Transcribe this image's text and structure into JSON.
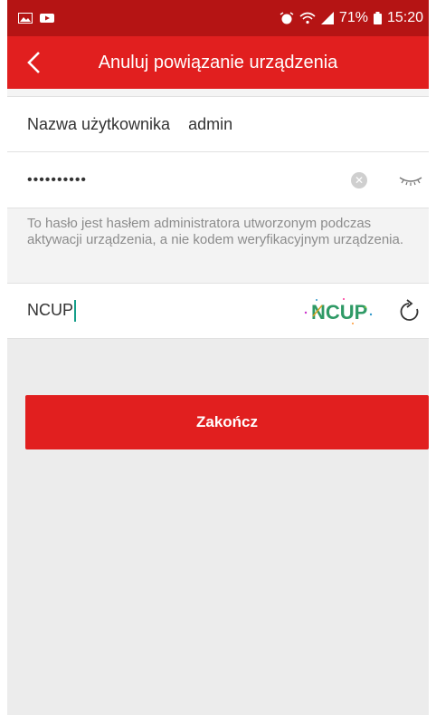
{
  "status_bar": {
    "battery": "71%",
    "time": "15:20",
    "icons": [
      "image-icon",
      "video-icon",
      "alarm-icon",
      "wifi-icon",
      "signal-icon",
      "battery-icon"
    ]
  },
  "header": {
    "title": "Anuluj powiązanie urządzenia",
    "back_icon": "chevron-left-icon"
  },
  "form": {
    "username_label": "Nazwa użytkownika",
    "username_value": "admin",
    "password_mask": "••••••••••",
    "password_hint": "To hasło jest hasłem administratora utworzonym podczas aktywacji urządzenia, a nie kodem weryfikacyjnym urządzenia.",
    "captcha_value": "NCUP",
    "captcha_image_text": "NCUP"
  },
  "actions": {
    "finish_label": "Zakończ"
  },
  "colors": {
    "accent": "#e11f1f",
    "status_bar": "#b51414",
    "caret": "#159e8a"
  }
}
